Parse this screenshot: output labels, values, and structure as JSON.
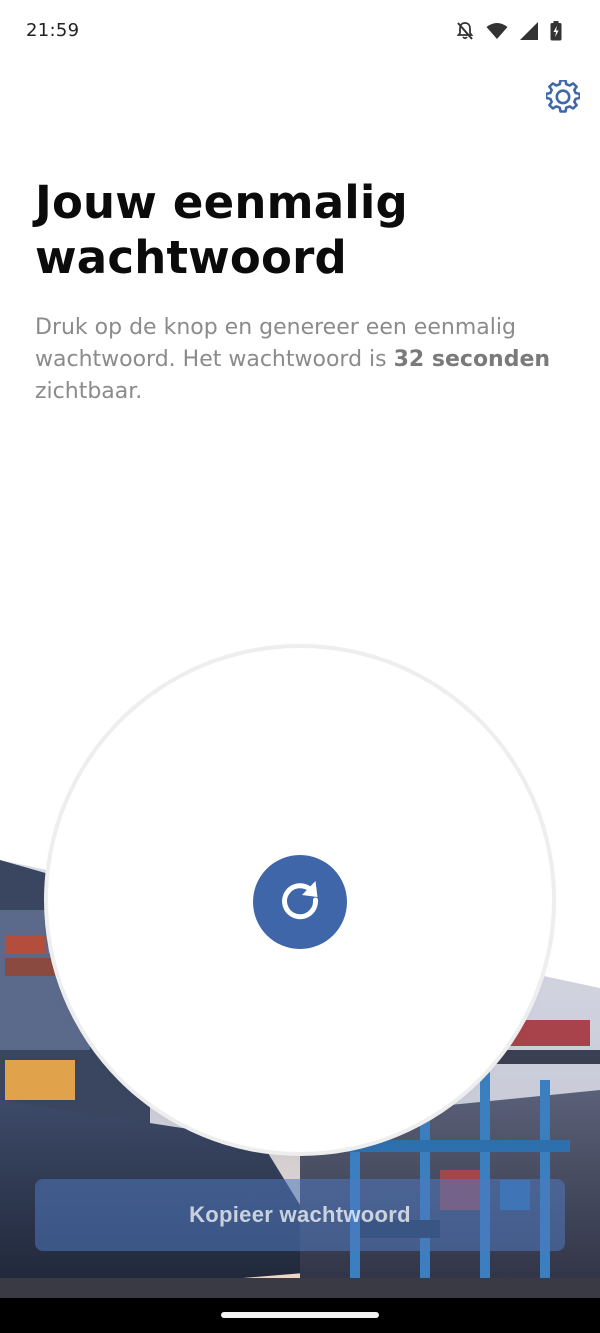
{
  "status_bar": {
    "time": "21:59"
  },
  "header": {
    "settings_icon": "gear-icon"
  },
  "content": {
    "title": "Jouw eenmalig wachtwoord",
    "description_prefix": "Druk op de knop en genereer een eenmalig wachtwoord. Het wachtwoord is ",
    "seconds_emphasis": "32 seconden",
    "description_suffix": " zichtbaar."
  },
  "generator": {
    "refresh_icon": "refresh-icon"
  },
  "actions": {
    "copy_label": "Kopieer wachtwoord"
  },
  "colors": {
    "accent": "#3f66a8",
    "text_primary": "#0b0b0b",
    "text_secondary": "#8b8b8b"
  }
}
